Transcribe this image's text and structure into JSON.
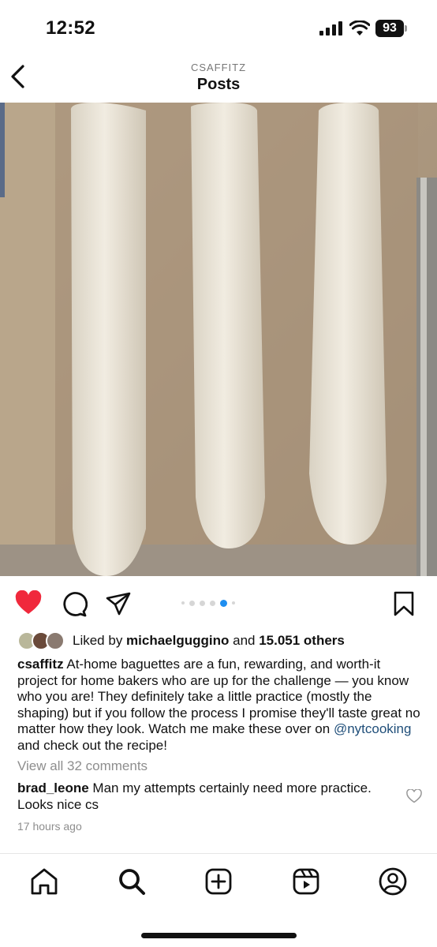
{
  "status": {
    "time": "12:52",
    "battery": "93"
  },
  "header": {
    "account": "CSAFFITZ",
    "title": "Posts"
  },
  "post": {
    "carousel": {
      "count": 6,
      "active_index": 4
    },
    "likes": {
      "prefix": "Liked by ",
      "user": "michaelguggino",
      "middle": " and ",
      "others": "15.051 others"
    },
    "caption": {
      "user": "csaffitz",
      "text_before": " At-home baguettes are a fun, rewarding, and worth-it project for home bakers who are up for the challenge — you know who you are! They definitely take a little practice (mostly the shaping) but if you follow the process I promise they'll taste great no matter how they look. Watch me make these over on ",
      "mention": "@nytcooking",
      "text_after": " and check out the recipe!"
    },
    "view_comments": "View all 32 comments",
    "comment": {
      "user": "brad_leone",
      "text": " Man my attempts certainly need more practice.  Looks nice cs"
    },
    "time_ago": "17 hours ago"
  },
  "colors": {
    "like_red": "#f0293c",
    "mention": "#1f4e79",
    "dot_active": "#1e8ef0"
  },
  "icons": [
    "back-arrow-icon",
    "heart-filled-icon",
    "comment-icon",
    "share-icon",
    "bookmark-icon",
    "small-heart-icon",
    "home-icon",
    "search-icon",
    "create-icon",
    "reels-icon",
    "profile-icon"
  ]
}
